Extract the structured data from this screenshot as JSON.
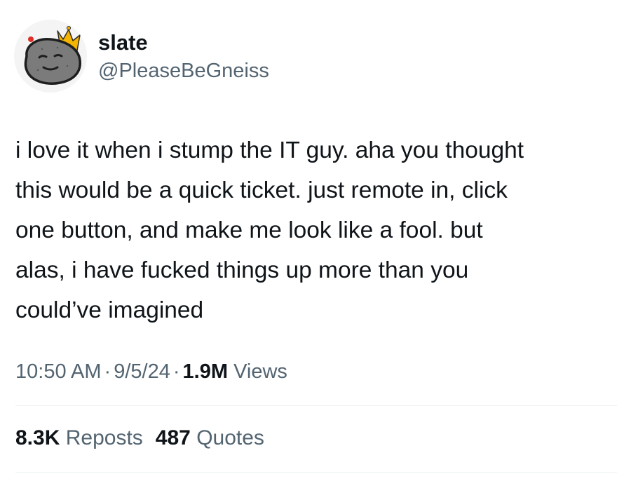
{
  "user": {
    "display_name": "slate",
    "handle": "@PleaseBeGneiss",
    "avatar_icon": "rock-face-with-crown-icon"
  },
  "tweet": {
    "text": "i love it when i stump the IT guy. aha you thought\nthis would be a quick ticket. just remote in, click\none button, and make me look like a fool. but\nalas, i have fucked things up more than you\ncould’ve imagined"
  },
  "meta": {
    "time": "10:50 AM",
    "separator": "·",
    "date": "9/5/24",
    "views_count": "1.9M",
    "views_label": "Views"
  },
  "stats": {
    "reposts_count": "8.3K",
    "reposts_label": "Reposts",
    "quotes_count": "487",
    "quotes_label": "Quotes"
  },
  "colors": {
    "text_primary": "#0f1419",
    "text_secondary": "#536471",
    "divider": "#eff3f4",
    "crown": "#f5b400"
  }
}
